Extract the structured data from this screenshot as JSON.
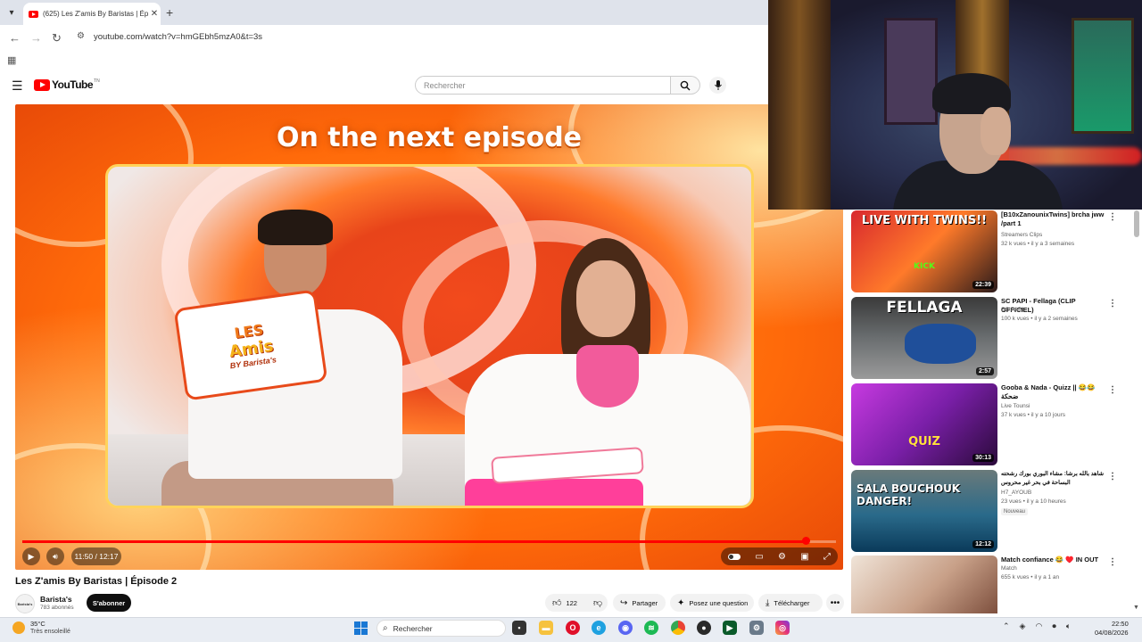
{
  "browser": {
    "tab_title": "(625) Les Z'amis By Baristas | Ép",
    "tab_close": "✕",
    "new_tab": "+",
    "url": "youtube.com/watch?v=hmGEbh5mzA0&t=3s",
    "icons": [
      "back-icon",
      "forward-icon",
      "reload-icon",
      "site-settings-icon",
      "apps-icon"
    ]
  },
  "header": {
    "logo_text": "YouTube",
    "logo_suffix": "TN",
    "search_placeholder": "Rechercher"
  },
  "player": {
    "overlay_title": "On the next episode",
    "sign_line1": "LES",
    "sign_line2": "Amis",
    "sign_line3": "BY Barista's",
    "time_display": "11:50 / 12:17",
    "progress_fraction": 0.963
  },
  "video": {
    "title": "Les Z'amis By Baristas | Épisode 2",
    "channel_name": "Barista's",
    "channel_avatar_text": "Barista's",
    "subscribers": "783 abonnés",
    "subscribe_label": "S'abonner",
    "like_count": "122",
    "share_label": "Partager",
    "ask_label": "Posez une question",
    "download_label": "Télécharger"
  },
  "recommendations": [
    {
      "title": "[B10xZanounixTwins] brcha jww /part 1",
      "channel": "Streamers Clips",
      "meta": "32 k vues • il y a 3 semaines",
      "duration": "22:39",
      "thumb_text": "LIVE WITH TWINS!!",
      "thumb_sub": "KICK",
      "badge": ""
    },
    {
      "title": "SC PAPI - Fellaga (CLIP OFFICIEL)",
      "channel": "SC PAPI",
      "meta": "100 k vues • il y a 2 semaines",
      "duration": "2:57",
      "thumb_text": "FELLAGA",
      "thumb_sub": "",
      "badge": ""
    },
    {
      "title": "Gooba & Nada - Quizz || 😂😂 ضحكة",
      "channel": "Live Tounsi",
      "meta": "37 k vues • il y a 10 jours",
      "duration": "30:13",
      "thumb_text": "QUIZ",
      "thumb_sub": "",
      "badge": ""
    },
    {
      "title": "شاهد بالله برشا: مشاء البوري بورك رشحته البساحة في بحر غير محروس",
      "channel": "H7_AYOUB",
      "meta": "23 vues • il y a 10 heures",
      "duration": "12:12",
      "thumb_text": "SALA BOUCHOUK DANGER!",
      "thumb_sub": "",
      "badge": "Nouveau"
    },
    {
      "title": "Match confiance 😂 ♥️ IN OUT",
      "channel": "Match",
      "meta": "655 k vues • il y a 1 an",
      "duration": "",
      "thumb_text": "",
      "thumb_sub": "",
      "badge": ""
    }
  ],
  "taskbar": {
    "temperature": "35°C",
    "weather": "Très ensoleillé",
    "search_label": "Rechercher",
    "time": "22:50",
    "date": "04/08/2026"
  },
  "colors": {
    "youtube_red": "#ff0000",
    "progress": "#ff0000",
    "subscribe_bg": "#0f0f0f"
  }
}
